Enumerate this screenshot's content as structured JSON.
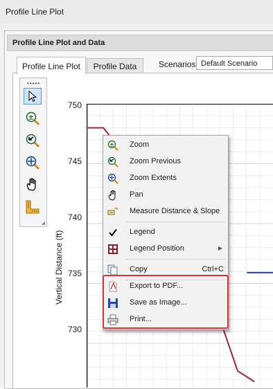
{
  "window": {
    "title": "Profile Line Plot"
  },
  "panel": {
    "header": "Profile Line Plot and Data"
  },
  "tabs": [
    {
      "label": "Profile Line Plot",
      "active": true
    },
    {
      "label": "Profile Data",
      "active": false
    }
  ],
  "scenarios": {
    "label": "Scenarios:",
    "value": "Default Scenario"
  },
  "toolbar": {
    "grip": "•••••",
    "tools": [
      "select-arrow-icon",
      "zoom-icon",
      "zoom-previous-icon",
      "zoom-extents-icon",
      "pan-hand-icon",
      "measure-ruler-icon"
    ]
  },
  "chart_data": {
    "type": "line",
    "ylabel": "Vertical Distance (ft)",
    "yticks": [
      "750",
      "745",
      "740",
      "735",
      "730"
    ],
    "ylim": [
      726.3,
      750
    ],
    "grid": true,
    "series": [
      {
        "color": "#a0282d",
        "points": [
          [
            0,
            748
          ],
          [
            0.09,
            748
          ],
          [
            0.13,
            747.2
          ],
          [
            0.72,
            731.8
          ],
          [
            0.81,
            727.7
          ],
          [
            0.9,
            726.8
          ]
        ]
      },
      {
        "color": "#1f3fd8",
        "points": [
          [
            0.86,
            735.9
          ],
          [
            1.0,
            735.9
          ]
        ]
      }
    ]
  },
  "context_menu": {
    "items": [
      {
        "label": "Zoom",
        "icon": "zoom-icon"
      },
      {
        "label": "Zoom Previous",
        "icon": "zoom-previous-icon"
      },
      {
        "label": "Zoom Extents",
        "icon": "zoom-extents-icon"
      },
      {
        "label": "Pan",
        "icon": "pan-hand-icon"
      },
      {
        "label": "Measure Distance & Slope",
        "icon": "measure-icon"
      },
      {
        "label": "Legend",
        "icon": "checkmark-icon",
        "checked": true
      },
      {
        "label": "Legend Position",
        "icon": "legend-position-icon",
        "submenu": true
      },
      {
        "label": "Copy",
        "shortcut": "Ctrl+C",
        "icon": "copy-icon"
      },
      {
        "label": "Export to PDF...",
        "icon": "pdf-icon"
      },
      {
        "label": "Save as Image...",
        "icon": "save-icon"
      },
      {
        "label": "Print...",
        "icon": "printer-icon"
      }
    ]
  },
  "highlight_color": "#d9343c"
}
